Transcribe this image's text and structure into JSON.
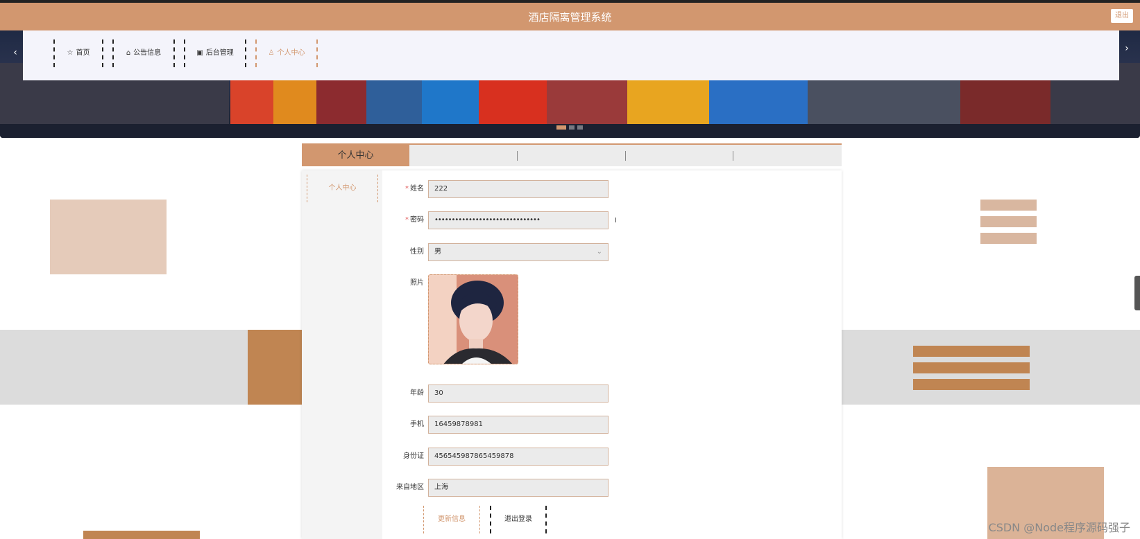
{
  "header": {
    "title": "酒店隔离管理系统",
    "logout_label": "退出"
  },
  "nav": {
    "items": [
      {
        "label": "首页",
        "icon": "star-icon"
      },
      {
        "label": "公告信息",
        "icon": "bag-icon"
      },
      {
        "label": "后台管理",
        "icon": "box-icon"
      },
      {
        "label": "个人中心",
        "icon": "user-icon"
      }
    ],
    "active_index": 3
  },
  "breadcrumb": {
    "current": "个人中心"
  },
  "sidebar": {
    "items": [
      {
        "label": "个人中心"
      }
    ]
  },
  "form": {
    "name": {
      "label": "姓名",
      "value": "222",
      "required": true
    },
    "password": {
      "label": "密码",
      "value": "•••••••••••••••••••••••••••••••",
      "required": true
    },
    "gender": {
      "label": "性别",
      "value": "男"
    },
    "photo": {
      "label": "照片"
    },
    "age": {
      "label": "年龄",
      "value": "30"
    },
    "phone": {
      "label": "手机",
      "value": "16459878981"
    },
    "id_card": {
      "label": "身份证",
      "value": "456545987865459878"
    },
    "region": {
      "label": "来自地区",
      "value": "上海"
    },
    "update_label": "更新信息",
    "logout_label": "退出登录"
  },
  "watermark": "CSDN @Node程序源码强子",
  "colors": {
    "accent": "#d2976f",
    "nav_bg": "#f4f4fb",
    "deco_light": "#e5cbba",
    "deco_dark": "#c08552",
    "band": "#dcdcdc"
  }
}
